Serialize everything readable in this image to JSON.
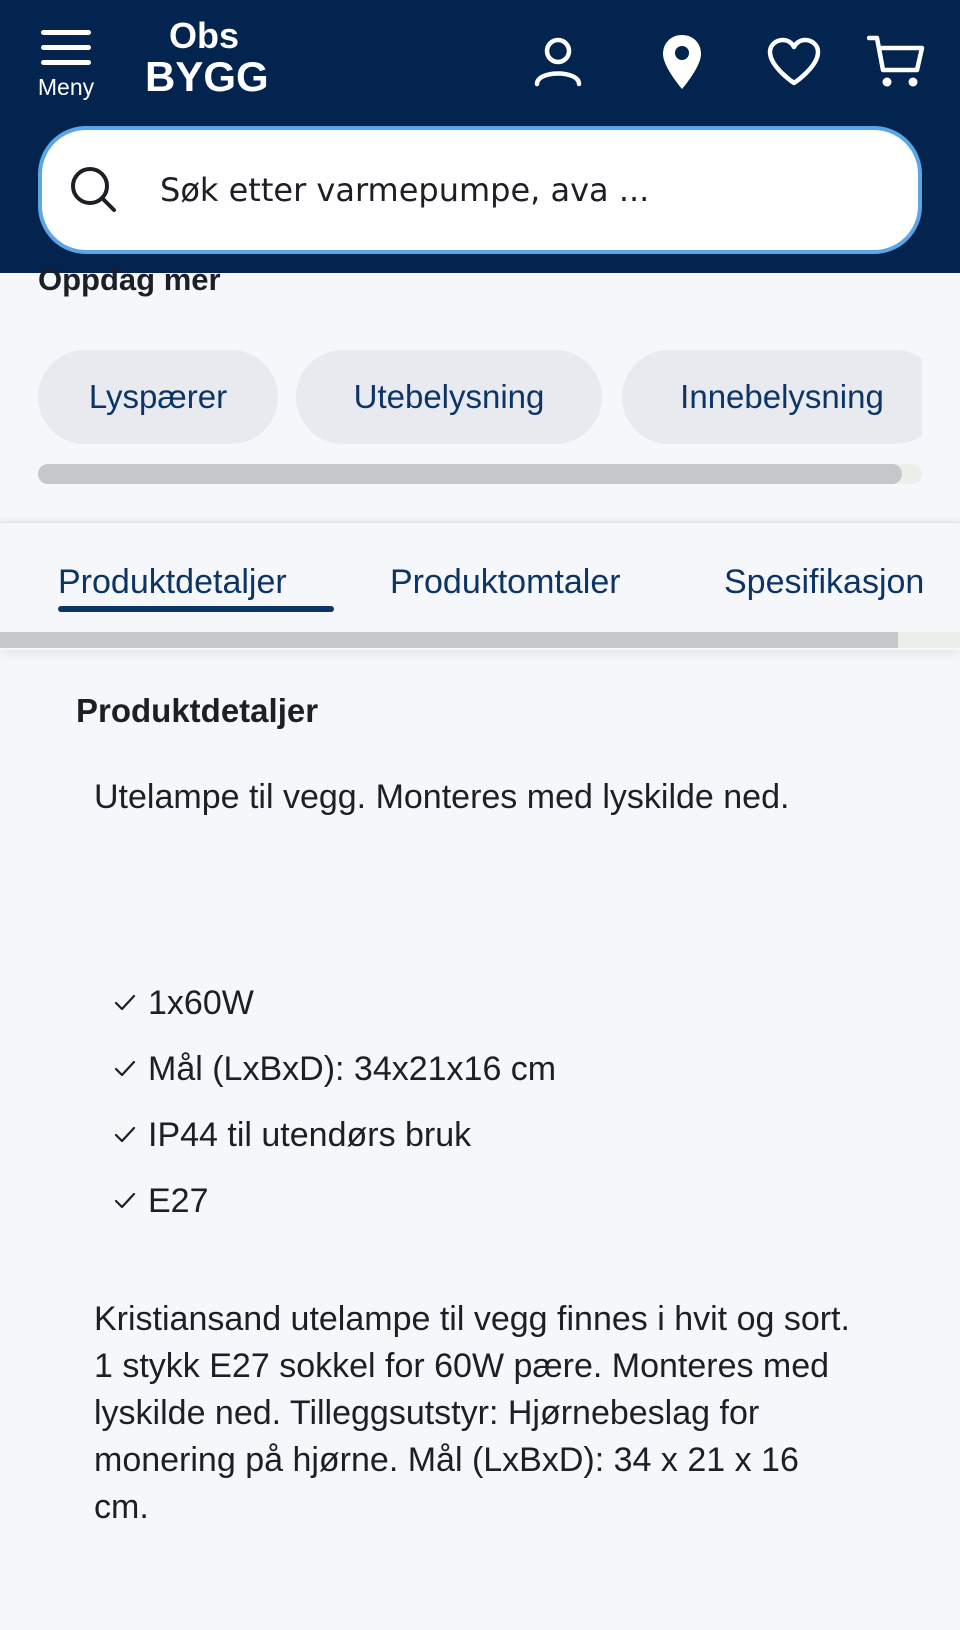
{
  "header": {
    "menu_label": "Meny",
    "logo_top": "Obs",
    "logo_bottom": "BYGG",
    "icons": [
      "menu-icon",
      "user-icon",
      "location-pin-icon",
      "heart-icon",
      "cart-icon"
    ],
    "background_color": "#02244f"
  },
  "search": {
    "placeholder": "Søk etter varmepumpe, ava ...",
    "border_color": "#5aa6e6"
  },
  "discover": {
    "title": "Oppdag mer",
    "chips": [
      {
        "label": "Lyspærer"
      },
      {
        "label": "Utebelysning"
      },
      {
        "label": "Innebelysning"
      }
    ]
  },
  "tabs": {
    "items": [
      {
        "label": "Produktdetaljer",
        "active": true
      },
      {
        "label": "Produktomtaler",
        "active": false
      },
      {
        "label": "Spesifikasjon",
        "active": false
      }
    ],
    "accent_color": "#0c3566"
  },
  "details": {
    "title": "Produktdetaljer",
    "intro": "Utelampe til vegg. Monteres med lyskilde ned.",
    "features": [
      "1x60W",
      "Mål (LxBxD): 34x21x16 cm",
      "IP44 til utendørs bruk",
      "E27"
    ],
    "description": "Kristiansand utelampe til vegg finnes i hvit og sort. 1 stykk E27 sokkel for 60W pære. Monteres med lyskilde ned. Tilleggsutstyr: Hjørnebeslag for monering på hjørne. Mål (LxBxD): 34 x 21 x 16 cm."
  }
}
